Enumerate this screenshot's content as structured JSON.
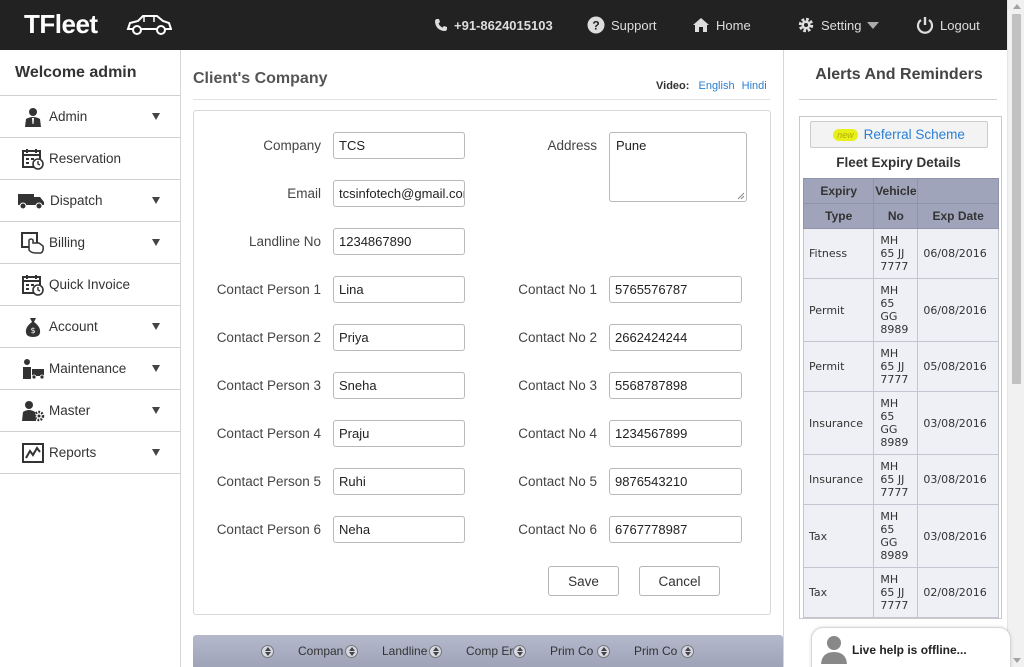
{
  "brand": {
    "name": "TFleet"
  },
  "topnav": {
    "phone": "+91-8624015103",
    "support": "Support",
    "home": "Home",
    "setting": "Setting",
    "logout": "Logout"
  },
  "sidebar": {
    "welcome": "Welcome admin",
    "items": [
      {
        "label": "Admin",
        "icon": "user-icon",
        "has_caret": true
      },
      {
        "label": "Reservation",
        "icon": "calendar-icon",
        "has_caret": false
      },
      {
        "label": "Dispatch",
        "icon": "truck-icon",
        "has_caret": true
      },
      {
        "label": "Billing",
        "icon": "billing-hand-icon",
        "has_caret": true
      },
      {
        "label": "Quick Invoice",
        "icon": "calendar-icon",
        "has_caret": false
      },
      {
        "label": "Account",
        "icon": "money-bag-icon",
        "has_caret": true
      },
      {
        "label": "Maintenance",
        "icon": "mechanic-icon",
        "has_caret": true
      },
      {
        "label": "Master",
        "icon": "user-gear-icon",
        "has_caret": true
      },
      {
        "label": "Reports",
        "icon": "chart-icon",
        "has_caret": true
      }
    ]
  },
  "main": {
    "title": "Client's Company",
    "video_label": "Video:",
    "video_english": "English",
    "video_hindi": "Hindi"
  },
  "form": {
    "company_label": "Company",
    "company_value": "TCS",
    "address_label": "Address",
    "address_value": "Pune",
    "email_label": "Email",
    "email_value": "tcsinfotech@gmail.com",
    "landline_label": "Landline No",
    "landline_value": "1234867890",
    "contacts": [
      {
        "person_label": "Contact Person 1",
        "person_value": "Lina",
        "no_label": "Contact No 1",
        "no_value": "5765576787"
      },
      {
        "person_label": "Contact Person 2",
        "person_value": "Priya",
        "no_label": "Contact No 2",
        "no_value": "2662424244"
      },
      {
        "person_label": "Contact Person 3",
        "person_value": "Sneha",
        "no_label": "Contact No 3",
        "no_value": "5568787898"
      },
      {
        "person_label": "Contact Person 4",
        "person_value": "Praju",
        "no_label": "Contact No 4",
        "no_value": "1234567899"
      },
      {
        "person_label": "Contact Person 5",
        "person_value": "Ruhi",
        "no_label": "Contact No 5",
        "no_value": "9876543210"
      },
      {
        "person_label": "Contact Person 6",
        "person_value": "Neha",
        "no_label": "Contact No 6",
        "no_value": "6767778987"
      }
    ],
    "save_label": "Save",
    "cancel_label": "Cancel"
  },
  "grid": {
    "columns": [
      "Compan",
      "Landline",
      "Comp Er",
      "Prim Co",
      "Prim Co"
    ]
  },
  "alerts": {
    "title": "Alerts And Reminders",
    "new_badge": "new",
    "referral": "Referral Scheme",
    "expiry_title": "Fleet Expiry Details",
    "headers_top": [
      "Expiry",
      "Vehicle",
      ""
    ],
    "headers_bottom": [
      "Type",
      "No",
      "Exp Date"
    ],
    "rows": [
      {
        "type": "Fitness",
        "vno": "MH 65 JJ 7777",
        "date": "06/08/2016"
      },
      {
        "type": "Permit",
        "vno": "MH 65 GG 8989",
        "date": "06/08/2016"
      },
      {
        "type": "Permit",
        "vno": "MH 65 JJ 7777",
        "date": "05/08/2016"
      },
      {
        "type": "Insurance",
        "vno": "MH 65 GG 8989",
        "date": "03/08/2016"
      },
      {
        "type": "Insurance",
        "vno": "MH 65 JJ 7777",
        "date": "03/08/2016"
      },
      {
        "type": "Tax",
        "vno": "MH 65 GG 8989",
        "date": "03/08/2016"
      },
      {
        "type": "Tax",
        "vno": "MH 65 JJ 7777",
        "date": "02/08/2016"
      }
    ]
  },
  "livehelp": {
    "text": "Live help is offline..."
  }
}
